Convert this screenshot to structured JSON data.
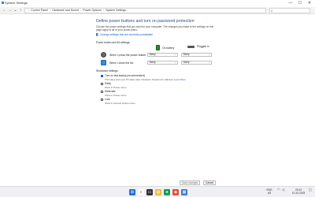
{
  "window": {
    "title": "System Settings"
  },
  "controls": {
    "minimize": "—",
    "maximize": "☐",
    "close": "✕"
  },
  "address": {
    "crumbs": [
      "Control Panel",
      "Hardware and Sound",
      "Power Options",
      "System Settings"
    ]
  },
  "search": {
    "placeholder": ""
  },
  "page": {
    "heading": "Define power buttons and turn on password protection",
    "description": "Choose the power settings that you want for your computer. The changes you make to the settings on this page apply to all of your power plans.",
    "change_link": "Change settings that are currently unavailable"
  },
  "power_section": {
    "title": "Power button and lid settings:",
    "col_battery": "On battery",
    "col_plugged": "Plugged in",
    "rows": [
      {
        "label": "When I press the power button:",
        "battery": "Sleep",
        "plugged": "Sleep"
      },
      {
        "label": "When I close the lid:",
        "battery": "Sleep",
        "plugged": "Sleep"
      }
    ]
  },
  "shutdown": {
    "title": "Shutdown settings",
    "options": [
      {
        "label": "Turn on fast startup (recommended)",
        "checked": true,
        "sub": "This helps start your PC faster after shutdown. Restart isn't affected.",
        "learn_more": "Learn More"
      },
      {
        "label": "Sleep",
        "checked": false,
        "sub": "Show in Power menu."
      },
      {
        "label": "Hibernate",
        "checked": false,
        "sub": "Show in Power menu."
      },
      {
        "label": "Lock",
        "checked": false,
        "sub": "Show in account picture menu."
      }
    ]
  },
  "buttons": {
    "save": "Save changes",
    "cancel": "Cancel"
  },
  "taskbar": {
    "lang_top": "ENG",
    "lang_bottom": "US",
    "time": "23:14",
    "date": "10-10-2023"
  }
}
